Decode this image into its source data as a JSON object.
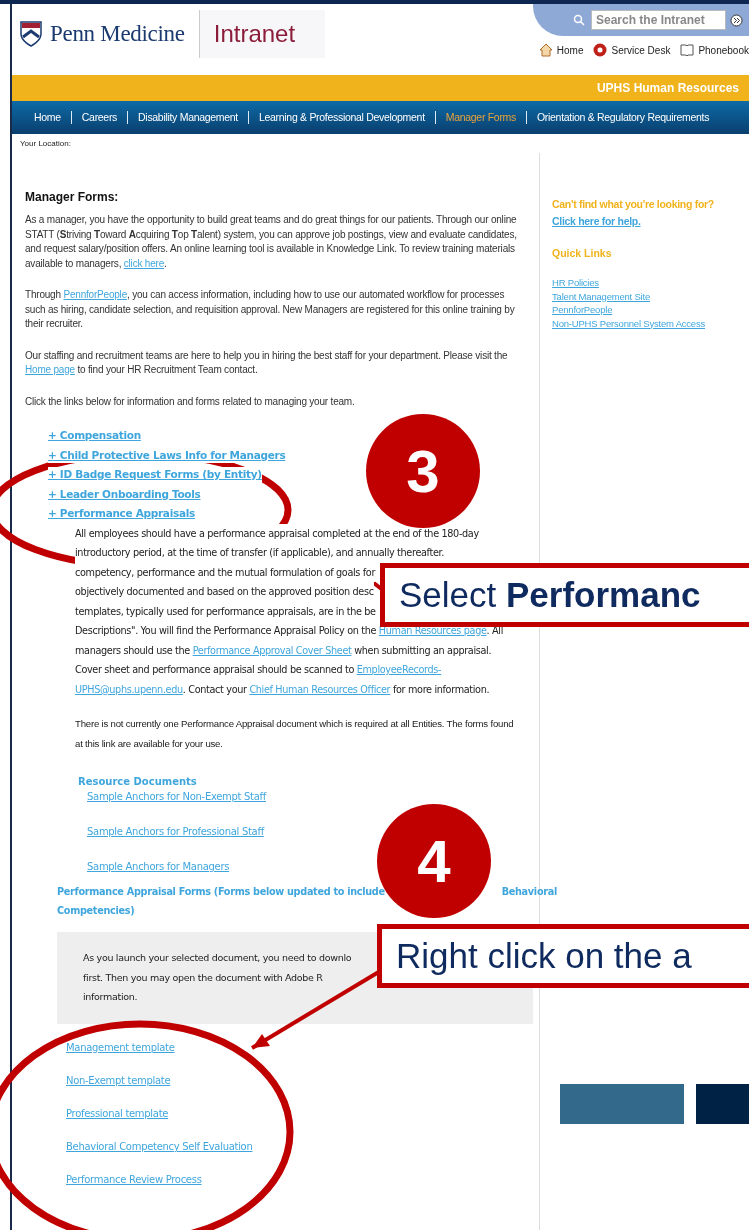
{
  "header": {
    "logo": "Penn Medicine",
    "site": "Intranet",
    "search": {
      "placeholder": "Search the Intranet"
    },
    "utility_links": [
      {
        "label": "Home",
        "kind": "home"
      },
      {
        "label": "Service Desk",
        "kind": "support"
      },
      {
        "label": "Phonebook",
        "kind": "directory"
      }
    ]
  },
  "banner": "UPHS Human Resources",
  "nav": [
    {
      "label": "Home",
      "selected": false
    },
    {
      "label": "Careers",
      "selected": false
    },
    {
      "label": "Disability Management",
      "selected": false
    },
    {
      "label": "Learning & Professional Development",
      "selected": false
    },
    {
      "label": "Manager Forms",
      "selected": true
    },
    {
      "label": "Orientation & Regulatory Requirements",
      "selected": false
    }
  ],
  "location_label": "Your Location:",
  "main": {
    "title": "Manager Forms:",
    "paragraphs": [
      [
        {
          "text": "As a manager, you have the opportunity to build great teams and do great things for our patients. Through our online STATT ("
        },
        {
          "text": "S",
          "bold": true
        },
        {
          "text": "triving "
        },
        {
          "text": "T",
          "bold": true
        },
        {
          "text": "oward "
        },
        {
          "text": "A",
          "bold": true
        },
        {
          "text": "cquiring "
        },
        {
          "text": "T",
          "bold": true
        },
        {
          "text": "op "
        },
        {
          "text": "T",
          "bold": true
        },
        {
          "text": "alent) system, you can approve job postings, view and evaluate candidates, and request salary/position offers. An online learning tool is available in Knowledge Link. To review training materials available to managers, "
        },
        {
          "text": "click here",
          "link": true
        },
        {
          "text": "."
        }
      ],
      [
        {
          "text": "Through "
        },
        {
          "text": "PennforPeople",
          "link": true
        },
        {
          "text": ", you can access information, including how to use our automated workflow for processes such as hiring, candidate selection, and requisition approval. New Managers are registered for this online training by their recruiter."
        }
      ],
      [
        {
          "text": "Our staffing and recruitment teams are here to help you in hiring the best staff for your department. Please visit the "
        },
        {
          "text": "Home page",
          "link": true
        },
        {
          "text": " to find your HR Recruitment Team contact."
        }
      ],
      [
        {
          "text": "Click the links below for information and forms related to managing your team."
        }
      ]
    ],
    "sections": [
      "+ Compensation",
      "+ Child Protective Laws Info for Managers",
      "+ ID Badge Request Forms (by Entity)",
      "+ Leader Onboarding Tools",
      "+ Performance Appraisals"
    ],
    "appraisal_lines": [
      [
        {
          "text": "All employees should have a performance appraisal completed at the end of the 180-day"
        }
      ],
      [
        {
          "text": "introductory period, at the time of transfer (if applicable), and annually thereafter."
        }
      ],
      [
        {
          "text": "competency, performance and the mutual formulation of goals for"
        }
      ],
      [
        {
          "text": "objectively documented and based on the approved position desc"
        }
      ],
      [
        {
          "text": "templates, typically used for performance appraisals, are in the be"
        }
      ],
      [
        {
          "text": "Descriptions\". You will find the Performance Appraisal Policy on the "
        },
        {
          "text": "Human Resources page",
          "link": true
        },
        {
          "text": ". All"
        }
      ],
      [
        {
          "text": "managers should use the "
        },
        {
          "text": "Performance Approval Cover Sheet",
          "link": true
        },
        {
          "text": " when submitting an appraisal."
        }
      ],
      [
        {
          "text": "Cover sheet and performance appraisal should be scanned to "
        },
        {
          "text": "EmployeeRecords-",
          "link": true
        }
      ],
      [
        {
          "text": "UPHS@uphs.upenn.edu",
          "link": true
        },
        {
          "text": ". Contact your "
        },
        {
          "text": "Chief Human Resources Officer",
          "link": true
        },
        {
          "text": " for more information."
        }
      ]
    ],
    "note": "There is not currently one Performance Appraisal document which is required at all Entities. The forms found at this link are available for your use.",
    "resource_title": "Resource Documents",
    "resources": [
      "Sample Anchors for Non-Exempt Staff",
      "Sample Anchors for Professional Staff",
      "Sample Anchors for Managers"
    ],
    "forms_heading": [
      "Performance Appraisal Forms (Forms below updated to include",
      "Behavioral",
      "Competencies)"
    ],
    "notice_lines": [
      "As you launch your selected document, you need to downlo",
      "first. Then you may open the document with Adobe R",
      "information."
    ],
    "forms": [
      "Management template",
      "Non-Exempt template",
      "Professional template",
      "Behavioral Competency Self Evaluation",
      "Performance Review Process"
    ]
  },
  "sidebar": {
    "prompt": "Can't find what you're looking for?",
    "help_link": "Click here for help.",
    "quick_links_title": "Quick Links",
    "quick_links": [
      "HR Policies",
      "Talent Management Site",
      "PennforPeople",
      "Non-UPHS Personnel System Access"
    ]
  },
  "annotations": [
    {
      "number": "3",
      "callout": "Select **Performanc**"
    },
    {
      "number": "4",
      "callout": "Right click on the a"
    }
  ]
}
